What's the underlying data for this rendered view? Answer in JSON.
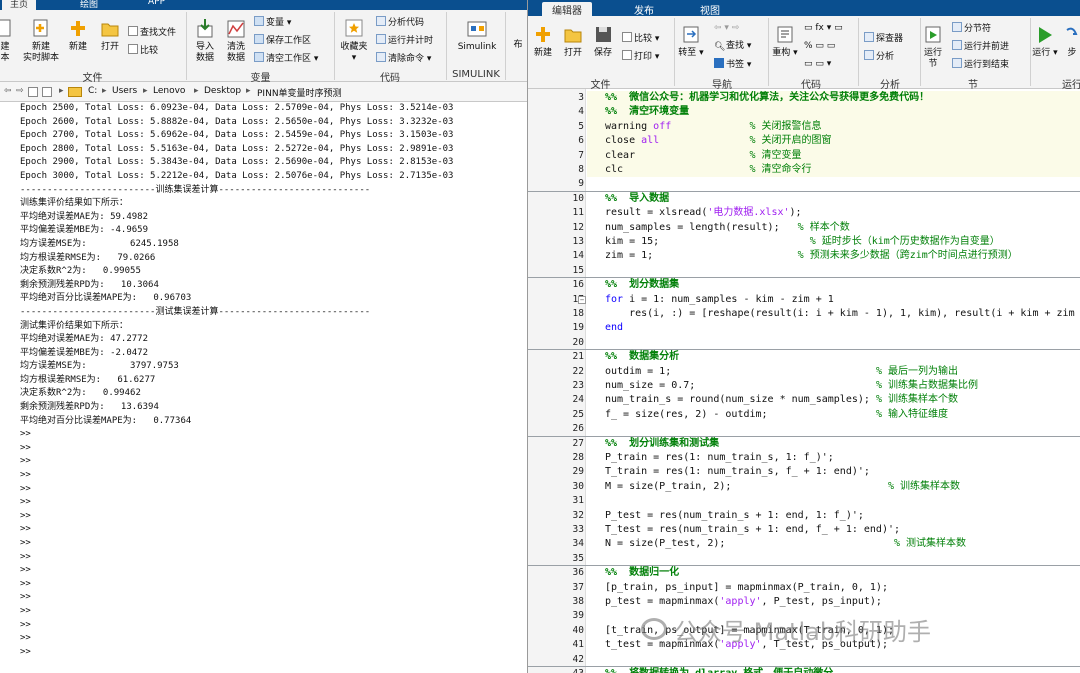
{
  "left": {
    "tabs": [
      "主页",
      "绘图",
      "APP"
    ],
    "ribbon": {
      "file": {
        "partial_new_label": "建\n本",
        "new_label": "新建\n实时脚本",
        "new2_label": "新建",
        "open_label": "打开",
        "find_files": "查找文件",
        "compare": "比较",
        "group": "文件"
      },
      "variable": {
        "import_label": "导入\n数据",
        "clean_label": "清洗\n数据",
        "variable_menu": "变量",
        "save_workspace": "保存工作区",
        "clear_workspace": "清空工作区",
        "group": "变量"
      },
      "code": {
        "favorites_label": "收藏夹",
        "analyze_code": "分析代码",
        "run_time": "运行并计时",
        "clear_commands": "清除命令",
        "group": "代码"
      },
      "simulink": {
        "label": "Simulink",
        "group": "SIMULINK"
      },
      "layout_label": "布"
    },
    "path": {
      "drive": "C:",
      "segments": [
        "Users",
        "Lenovo",
        "Desktop",
        "PINN单变量时序预测"
      ]
    },
    "console_lines": [
      "Epoch 2500, Total Loss: 6.0923e-04, Data Loss: 2.5709e-04, Phys Loss: 3.5214e-03",
      "Epoch 2600, Total Loss: 5.8882e-04, Data Loss: 2.5650e-04, Phys Loss: 3.3232e-03",
      "Epoch 2700, Total Loss: 5.6962e-04, Data Loss: 2.5459e-04, Phys Loss: 3.1503e-03",
      "Epoch 2800, Total Loss: 5.5163e-04, Data Loss: 2.5272e-04, Phys Loss: 2.9891e-03",
      "Epoch 2900, Total Loss: 5.3843e-04, Data Loss: 2.5690e-04, Phys Loss: 2.8153e-03",
      "Epoch 3000, Total Loss: 5.2212e-04, Data Loss: 2.5076e-04, Phys Loss: 2.7135e-03",
      "-------------------------训练集误差计算----------------------------",
      "训练集评价结果如下所示：",
      "平均绝对误差MAE为: 59.4982",
      "平均偏差误差MBE为: -4.9659",
      "均方误差MSE为:        6245.1958",
      "均方根误差RMSE为:   79.0266",
      "决定系数R^2为:   0.99055",
      "剩余预测残差RPD为:   10.3064",
      "平均绝对百分比误差MAPE为:   0.96703",
      "-------------------------测试集误差计算----------------------------",
      "测试集评价结果如下所示：",
      "平均绝对误差MAE为: 47.2772",
      "平均偏差误差MBE为: -2.0472",
      "均方误差MSE为:        3797.9753",
      "均方根误差RMSE为:   61.6277",
      "决定系数R^2为:   0.99462",
      "剩余预测残差RPD为:   13.6394",
      "平均绝对百分比误差MAPE为:   0.77364",
      ">>",
      ">>",
      ">>",
      ">>",
      ">>",
      ">>",
      ">>",
      ">>",
      ">>",
      ">>",
      ">>",
      ">>",
      ">>",
      ">>",
      ">>",
      ">>",
      ">>"
    ]
  },
  "right": {
    "tabs": [
      "编辑器",
      "发布",
      "视图"
    ],
    "ribbon": {
      "file": {
        "new_label": "新建",
        "open_label": "打开",
        "save_label": "保存",
        "compare": "比较",
        "print": "打印",
        "group": "文件"
      },
      "nav": {
        "goto_label": "转至",
        "find": "查找",
        "bookmark": "书签",
        "group": "导航"
      },
      "code": {
        "refactor_label": "重构",
        "group": "代码"
      },
      "analyze": {
        "profiler": "探查器",
        "analyze": "分析",
        "group": "分析"
      },
      "section": {
        "run_section_label": "运行\n节",
        "section_break": "分节符",
        "run_advance": "运行并前进",
        "run_to_end": "运行到结束",
        "group": "节"
      },
      "run": {
        "run_label": "运行",
        "step_label": "步",
        "group": "运行"
      }
    },
    "editor_lines": [
      {
        "no": "3",
        "segs": [
          {
            "t": "%%  微信公众号：机器学习和优化算法，关注公众号获得更多免费代码！",
            "c": "sec"
          }
        ]
      },
      {
        "no": "4",
        "segs": [
          {
            "t": "%%  清空环境变量",
            "c": "sec"
          }
        ]
      },
      {
        "no": "5",
        "segs": [
          {
            "t": "warning ",
            "c": ""
          },
          {
            "t": "off",
            "c": "str"
          },
          {
            "t": "             ",
            "c": ""
          },
          {
            "t": "% 关闭报警信息",
            "c": "cm"
          }
        ]
      },
      {
        "no": "6",
        "segs": [
          {
            "t": "close ",
            "c": ""
          },
          {
            "t": "all",
            "c": "str"
          },
          {
            "t": "               ",
            "c": ""
          },
          {
            "t": "% 关闭开启的图窗",
            "c": "cm"
          }
        ]
      },
      {
        "no": "7",
        "segs": [
          {
            "t": "clear                   ",
            "c": ""
          },
          {
            "t": "% 清空变量",
            "c": "cm"
          }
        ]
      },
      {
        "no": "8",
        "segs": [
          {
            "t": "clc                     ",
            "c": ""
          },
          {
            "t": "% 清空命令行",
            "c": "cm"
          }
        ]
      },
      {
        "no": "9",
        "segs": []
      },
      {
        "no": "10",
        "segs": [
          {
            "t": "%%  导入数据",
            "c": "sec"
          }
        ]
      },
      {
        "no": "11",
        "segs": [
          {
            "t": "result = xlsread(",
            "c": ""
          },
          {
            "t": "'电力数据.xlsx'",
            "c": "str"
          },
          {
            "t": ");",
            "c": ""
          }
        ]
      },
      {
        "no": "12",
        "segs": [
          {
            "t": "num_samples = length(result);   ",
            "c": ""
          },
          {
            "t": "% 样本个数",
            "c": "cm"
          }
        ]
      },
      {
        "no": "13",
        "segs": [
          {
            "t": "kim = 15;                         ",
            "c": ""
          },
          {
            "t": "% 延时步长（kim个历史数据作为自变量）",
            "c": "cm"
          }
        ]
      },
      {
        "no": "14",
        "segs": [
          {
            "t": "zim = 1;                        ",
            "c": ""
          },
          {
            "t": "% 预测未来多少数据（跨zim个时间点进行预测）",
            "c": "cm"
          }
        ]
      },
      {
        "no": "15",
        "segs": []
      },
      {
        "no": "16",
        "segs": [
          {
            "t": "%%  划分数据集",
            "c": "sec"
          }
        ]
      },
      {
        "no": "17",
        "segs": [
          {
            "t": "for",
            "c": "kw"
          },
          {
            "t": " i = 1: num_samples - kim - zim + 1",
            "c": ""
          }
        ]
      },
      {
        "no": "18",
        "segs": [
          {
            "t": "    res(i, :) = [reshape(result(i: i + kim - 1), 1, kim), result(i + kim + zim",
            "c": ""
          }
        ]
      },
      {
        "no": "19",
        "segs": [
          {
            "t": "end",
            "c": "kw"
          }
        ]
      },
      {
        "no": "20",
        "segs": []
      },
      {
        "no": "21",
        "segs": [
          {
            "t": "%%  数据集分析",
            "c": "sec"
          }
        ]
      },
      {
        "no": "22",
        "segs": [
          {
            "t": "outdim = 1;                                  ",
            "c": ""
          },
          {
            "t": "% 最后一列为输出",
            "c": "cm"
          }
        ]
      },
      {
        "no": "23",
        "segs": [
          {
            "t": "num_size = 0.7;                              ",
            "c": ""
          },
          {
            "t": "% 训练集占数据集比例",
            "c": "cm"
          }
        ]
      },
      {
        "no": "24",
        "segs": [
          {
            "t": "num_train_s = round(num_size * num_samples); ",
            "c": ""
          },
          {
            "t": "% 训练集样本个数",
            "c": "cm"
          }
        ]
      },
      {
        "no": "25",
        "segs": [
          {
            "t": "f_ = size(res, 2) - outdim;                  ",
            "c": ""
          },
          {
            "t": "% 输入特征维度",
            "c": "cm"
          }
        ]
      },
      {
        "no": "26",
        "segs": []
      },
      {
        "no": "27",
        "segs": [
          {
            "t": "%%  划分训练集和测试集",
            "c": "sec"
          }
        ]
      },
      {
        "no": "28",
        "segs": [
          {
            "t": "P_train = res(1: num_train_s, 1: f_)';",
            "c": ""
          }
        ]
      },
      {
        "no": "29",
        "segs": [
          {
            "t": "T_train = res(1: num_train_s, f_ + 1: end)';",
            "c": ""
          }
        ]
      },
      {
        "no": "30",
        "segs": [
          {
            "t": "M = size(P_train, 2);                          ",
            "c": ""
          },
          {
            "t": "% 训练集样本数",
            "c": "cm"
          }
        ]
      },
      {
        "no": "31",
        "segs": []
      },
      {
        "no": "32",
        "segs": [
          {
            "t": "P_test = res(num_train_s + 1: end, 1: f_)';",
            "c": ""
          }
        ]
      },
      {
        "no": "33",
        "segs": [
          {
            "t": "T_test = res(num_train_s + 1: end, f_ + 1: end)';",
            "c": ""
          }
        ]
      },
      {
        "no": "34",
        "segs": [
          {
            "t": "N = size(P_test, 2);                            ",
            "c": ""
          },
          {
            "t": "% 测试集样本数",
            "c": "cm"
          }
        ]
      },
      {
        "no": "35",
        "segs": []
      },
      {
        "no": "36",
        "segs": [
          {
            "t": "%%  数据归一化",
            "c": "sec"
          }
        ]
      },
      {
        "no": "37",
        "segs": [
          {
            "t": "[p_train, ps_input] = mapminmax(P_train, 0, 1);",
            "c": ""
          }
        ]
      },
      {
        "no": "38",
        "segs": [
          {
            "t": "p_test = mapminmax(",
            "c": ""
          },
          {
            "t": "'apply'",
            "c": "str"
          },
          {
            "t": ", P_test, ps_input);",
            "c": ""
          }
        ]
      },
      {
        "no": "39",
        "segs": []
      },
      {
        "no": "40",
        "segs": [
          {
            "t": "[t_train, ps_output] = mapminmax(T_train, 0, 1);",
            "c": ""
          }
        ]
      },
      {
        "no": "41",
        "segs": [
          {
            "t": "t_test = mapminmax(",
            "c": ""
          },
          {
            "t": "'apply'",
            "c": "str"
          },
          {
            "t": ", T_test, ps_output);",
            "c": ""
          }
        ]
      },
      {
        "no": "42",
        "segs": []
      },
      {
        "no": "43",
        "segs": [
          {
            "t": "%%  将数据转换为 dlarray 格式，便于自动微分",
            "c": "sec"
          }
        ]
      }
    ],
    "watermark": "公众号·Matlab科研助手"
  },
  "colors": {
    "tabstrip": "#0a4f8f",
    "ribbon": "#f3f3f3",
    "cell_highlight": "#fbfbe8",
    "keyword": "#0e00ff",
    "string": "#a020f0",
    "comment": "#028009"
  }
}
